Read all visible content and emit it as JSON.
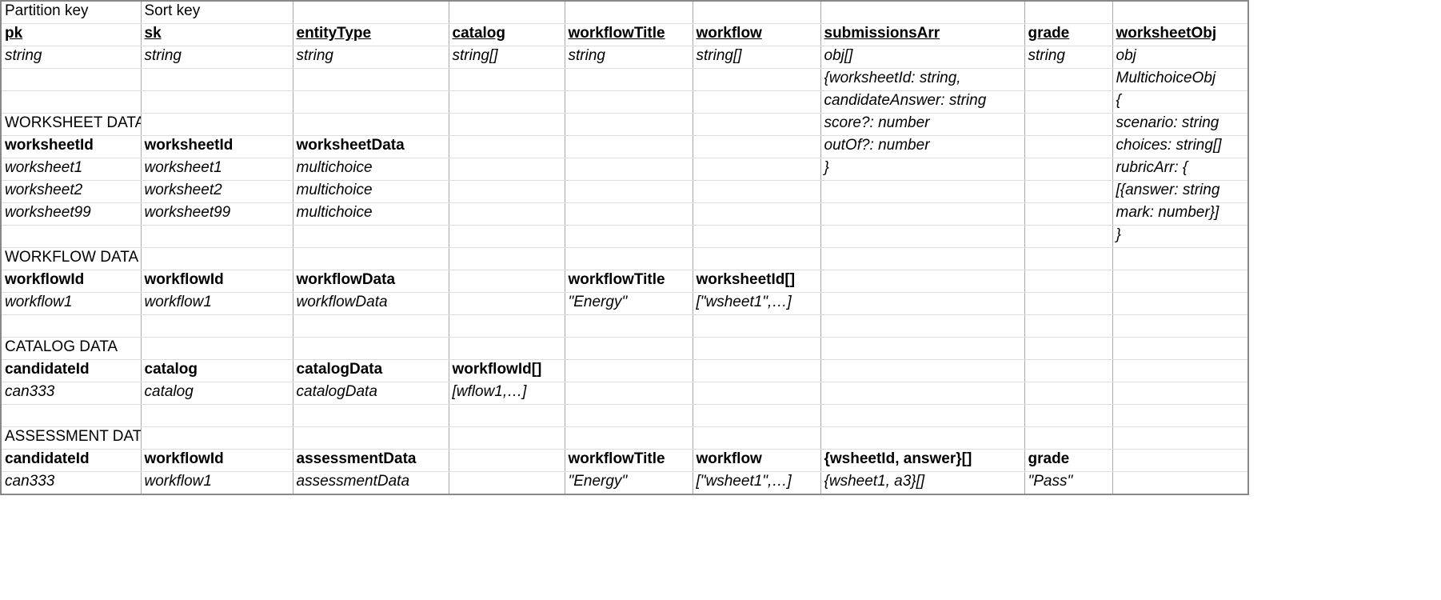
{
  "rows": [
    [
      {
        "text": "Partition key",
        "style": ""
      },
      {
        "text": "Sort key",
        "style": ""
      },
      {
        "text": "",
        "style": ""
      },
      {
        "text": "",
        "style": ""
      },
      {
        "text": "",
        "style": ""
      },
      {
        "text": "",
        "style": ""
      },
      {
        "text": "",
        "style": ""
      },
      {
        "text": "",
        "style": ""
      },
      {
        "text": "",
        "style": ""
      }
    ],
    [
      {
        "text": "pk",
        "style": "bu"
      },
      {
        "text": "sk",
        "style": "bu"
      },
      {
        "text": "entityType",
        "style": "bu"
      },
      {
        "text": "catalog",
        "style": "bu"
      },
      {
        "text": "workflowTitle",
        "style": "bu"
      },
      {
        "text": "workflow",
        "style": "bu"
      },
      {
        "text": "submissionsArr",
        "style": "bu"
      },
      {
        "text": "grade",
        "style": "bu"
      },
      {
        "text": "worksheetObj",
        "style": "bu"
      }
    ],
    [
      {
        "text": "string",
        "style": "italic"
      },
      {
        "text": "string",
        "style": "italic"
      },
      {
        "text": "string",
        "style": "italic"
      },
      {
        "text": "string[]",
        "style": "italic"
      },
      {
        "text": "string",
        "style": "italic"
      },
      {
        "text": "string[]",
        "style": "italic"
      },
      {
        "text": "obj[]",
        "style": "italic"
      },
      {
        "text": "string",
        "style": "italic"
      },
      {
        "text": "obj",
        "style": "italic"
      }
    ],
    [
      {
        "text": "",
        "style": ""
      },
      {
        "text": "",
        "style": ""
      },
      {
        "text": "",
        "style": ""
      },
      {
        "text": "",
        "style": ""
      },
      {
        "text": "",
        "style": ""
      },
      {
        "text": "",
        "style": ""
      },
      {
        "text": "{worksheetId: string,",
        "style": "italic"
      },
      {
        "text": "",
        "style": ""
      },
      {
        "text": "MultichoiceObj",
        "style": "italic"
      }
    ],
    [
      {
        "text": "",
        "style": ""
      },
      {
        "text": "",
        "style": ""
      },
      {
        "text": "",
        "style": ""
      },
      {
        "text": "",
        "style": ""
      },
      {
        "text": "",
        "style": ""
      },
      {
        "text": "",
        "style": ""
      },
      {
        "text": "candidateAnswer: string",
        "style": "italic"
      },
      {
        "text": "",
        "style": ""
      },
      {
        "text": "{",
        "style": "italic"
      }
    ],
    [
      {
        "text": "WORKSHEET DATA",
        "style": ""
      },
      {
        "text": "",
        "style": ""
      },
      {
        "text": "",
        "style": ""
      },
      {
        "text": "",
        "style": ""
      },
      {
        "text": "",
        "style": ""
      },
      {
        "text": "",
        "style": ""
      },
      {
        "text": "score?: number",
        "style": "italic"
      },
      {
        "text": "",
        "style": ""
      },
      {
        "text": "scenario: string",
        "style": "italic"
      }
    ],
    [
      {
        "text": "worksheetId",
        "style": "bold"
      },
      {
        "text": "worksheetId",
        "style": "bold"
      },
      {
        "text": "worksheetData",
        "style": "bold"
      },
      {
        "text": "",
        "style": ""
      },
      {
        "text": "",
        "style": ""
      },
      {
        "text": "",
        "style": ""
      },
      {
        "text": "outOf?: number",
        "style": "italic"
      },
      {
        "text": "",
        "style": ""
      },
      {
        "text": "choices: string[]",
        "style": "italic"
      }
    ],
    [
      {
        "text": "worksheet1",
        "style": "italic"
      },
      {
        "text": "worksheet1",
        "style": "italic"
      },
      {
        "text": "multichoice",
        "style": "italic"
      },
      {
        "text": "",
        "style": ""
      },
      {
        "text": "",
        "style": ""
      },
      {
        "text": "",
        "style": ""
      },
      {
        "text": "}",
        "style": "italic"
      },
      {
        "text": "",
        "style": ""
      },
      {
        "text": "rubricArr: {",
        "style": "italic"
      }
    ],
    [
      {
        "text": "worksheet2",
        "style": "italic"
      },
      {
        "text": "worksheet2",
        "style": "italic"
      },
      {
        "text": "multichoice",
        "style": "italic"
      },
      {
        "text": "",
        "style": ""
      },
      {
        "text": "",
        "style": ""
      },
      {
        "text": "",
        "style": ""
      },
      {
        "text": "",
        "style": ""
      },
      {
        "text": "",
        "style": ""
      },
      {
        "text": "[{answer: string",
        "style": "italic"
      }
    ],
    [
      {
        "text": "worksheet99",
        "style": "italic"
      },
      {
        "text": "worksheet99",
        "style": "italic"
      },
      {
        "text": "multichoice",
        "style": "italic"
      },
      {
        "text": "",
        "style": ""
      },
      {
        "text": "",
        "style": ""
      },
      {
        "text": "",
        "style": ""
      },
      {
        "text": "",
        "style": ""
      },
      {
        "text": "",
        "style": ""
      },
      {
        "text": "mark: number}]",
        "style": "italic"
      }
    ],
    [
      {
        "text": "",
        "style": ""
      },
      {
        "text": "",
        "style": ""
      },
      {
        "text": "",
        "style": ""
      },
      {
        "text": "",
        "style": ""
      },
      {
        "text": "",
        "style": ""
      },
      {
        "text": "",
        "style": ""
      },
      {
        "text": "",
        "style": ""
      },
      {
        "text": "",
        "style": ""
      },
      {
        "text": "}",
        "style": "italic"
      }
    ],
    [
      {
        "text": "WORKFLOW DATA",
        "style": ""
      },
      {
        "text": "",
        "style": ""
      },
      {
        "text": "",
        "style": ""
      },
      {
        "text": "",
        "style": ""
      },
      {
        "text": "",
        "style": ""
      },
      {
        "text": "",
        "style": ""
      },
      {
        "text": "",
        "style": ""
      },
      {
        "text": "",
        "style": ""
      },
      {
        "text": "",
        "style": ""
      }
    ],
    [
      {
        "text": "workflowId",
        "style": "bold"
      },
      {
        "text": "workflowId",
        "style": "bold"
      },
      {
        "text": "workflowData",
        "style": "bold"
      },
      {
        "text": "",
        "style": ""
      },
      {
        "text": "workflowTitle",
        "style": "bold"
      },
      {
        "text": "worksheetId[]",
        "style": "bold"
      },
      {
        "text": "",
        "style": ""
      },
      {
        "text": "",
        "style": ""
      },
      {
        "text": "",
        "style": ""
      }
    ],
    [
      {
        "text": "workflow1",
        "style": "italic"
      },
      {
        "text": "workflow1",
        "style": "italic"
      },
      {
        "text": "workflowData",
        "style": "italic"
      },
      {
        "text": "",
        "style": ""
      },
      {
        "text": "\"Energy\"",
        "style": "italic"
      },
      {
        "text": "[\"wsheet1\",…]",
        "style": "italic"
      },
      {
        "text": "",
        "style": ""
      },
      {
        "text": "",
        "style": ""
      },
      {
        "text": "",
        "style": ""
      }
    ],
    [
      {
        "text": "",
        "style": ""
      },
      {
        "text": "",
        "style": ""
      },
      {
        "text": "",
        "style": ""
      },
      {
        "text": "",
        "style": ""
      },
      {
        "text": "",
        "style": ""
      },
      {
        "text": "",
        "style": ""
      },
      {
        "text": "",
        "style": ""
      },
      {
        "text": "",
        "style": ""
      },
      {
        "text": "",
        "style": ""
      }
    ],
    [
      {
        "text": "CATALOG DATA",
        "style": ""
      },
      {
        "text": "",
        "style": ""
      },
      {
        "text": "",
        "style": ""
      },
      {
        "text": "",
        "style": ""
      },
      {
        "text": "",
        "style": ""
      },
      {
        "text": "",
        "style": ""
      },
      {
        "text": "",
        "style": ""
      },
      {
        "text": "",
        "style": ""
      },
      {
        "text": "",
        "style": ""
      }
    ],
    [
      {
        "text": "candidateId",
        "style": "bold"
      },
      {
        "text": "catalog",
        "style": "bold"
      },
      {
        "text": "catalogData",
        "style": "bold"
      },
      {
        "text": "workflowId[]",
        "style": "bold"
      },
      {
        "text": "",
        "style": ""
      },
      {
        "text": "",
        "style": ""
      },
      {
        "text": "",
        "style": ""
      },
      {
        "text": "",
        "style": ""
      },
      {
        "text": "",
        "style": ""
      }
    ],
    [
      {
        "text": "can333",
        "style": "italic"
      },
      {
        "text": "catalog",
        "style": "italic"
      },
      {
        "text": "catalogData",
        "style": "italic"
      },
      {
        "text": "[wflow1,…]",
        "style": "italic"
      },
      {
        "text": "",
        "style": ""
      },
      {
        "text": "",
        "style": ""
      },
      {
        "text": "",
        "style": ""
      },
      {
        "text": "",
        "style": ""
      },
      {
        "text": "",
        "style": ""
      }
    ],
    [
      {
        "text": "",
        "style": ""
      },
      {
        "text": "",
        "style": ""
      },
      {
        "text": "",
        "style": ""
      },
      {
        "text": "",
        "style": ""
      },
      {
        "text": "",
        "style": ""
      },
      {
        "text": "",
        "style": ""
      },
      {
        "text": "",
        "style": ""
      },
      {
        "text": "",
        "style": ""
      },
      {
        "text": "",
        "style": ""
      }
    ],
    [
      {
        "text": "ASSESSMENT DATA",
        "style": ""
      },
      {
        "text": "",
        "style": ""
      },
      {
        "text": "",
        "style": ""
      },
      {
        "text": "",
        "style": ""
      },
      {
        "text": "",
        "style": ""
      },
      {
        "text": "",
        "style": ""
      },
      {
        "text": "",
        "style": ""
      },
      {
        "text": "",
        "style": ""
      },
      {
        "text": "",
        "style": ""
      }
    ],
    [
      {
        "text": "candidateId",
        "style": "bold"
      },
      {
        "text": "workflowId",
        "style": "bold"
      },
      {
        "text": "assessmentData",
        "style": "bold"
      },
      {
        "text": "",
        "style": ""
      },
      {
        "text": "workflowTitle",
        "style": "bold"
      },
      {
        "text": "workflow",
        "style": "bold"
      },
      {
        "text": "{wsheetId, answer}[]",
        "style": "bold"
      },
      {
        "text": "grade",
        "style": "bold"
      },
      {
        "text": "",
        "style": ""
      }
    ],
    [
      {
        "text": "can333",
        "style": "italic"
      },
      {
        "text": "workflow1",
        "style": "italic"
      },
      {
        "text": "assessmentData",
        "style": "italic"
      },
      {
        "text": "",
        "style": ""
      },
      {
        "text": "\"Energy\"",
        "style": "italic"
      },
      {
        "text": "[\"wsheet1\",…]",
        "style": "italic"
      },
      {
        "text": "{wsheet1, a3}[]",
        "style": "italic"
      },
      {
        "text": "\"Pass\"",
        "style": "italic"
      },
      {
        "text": "",
        "style": ""
      }
    ]
  ]
}
